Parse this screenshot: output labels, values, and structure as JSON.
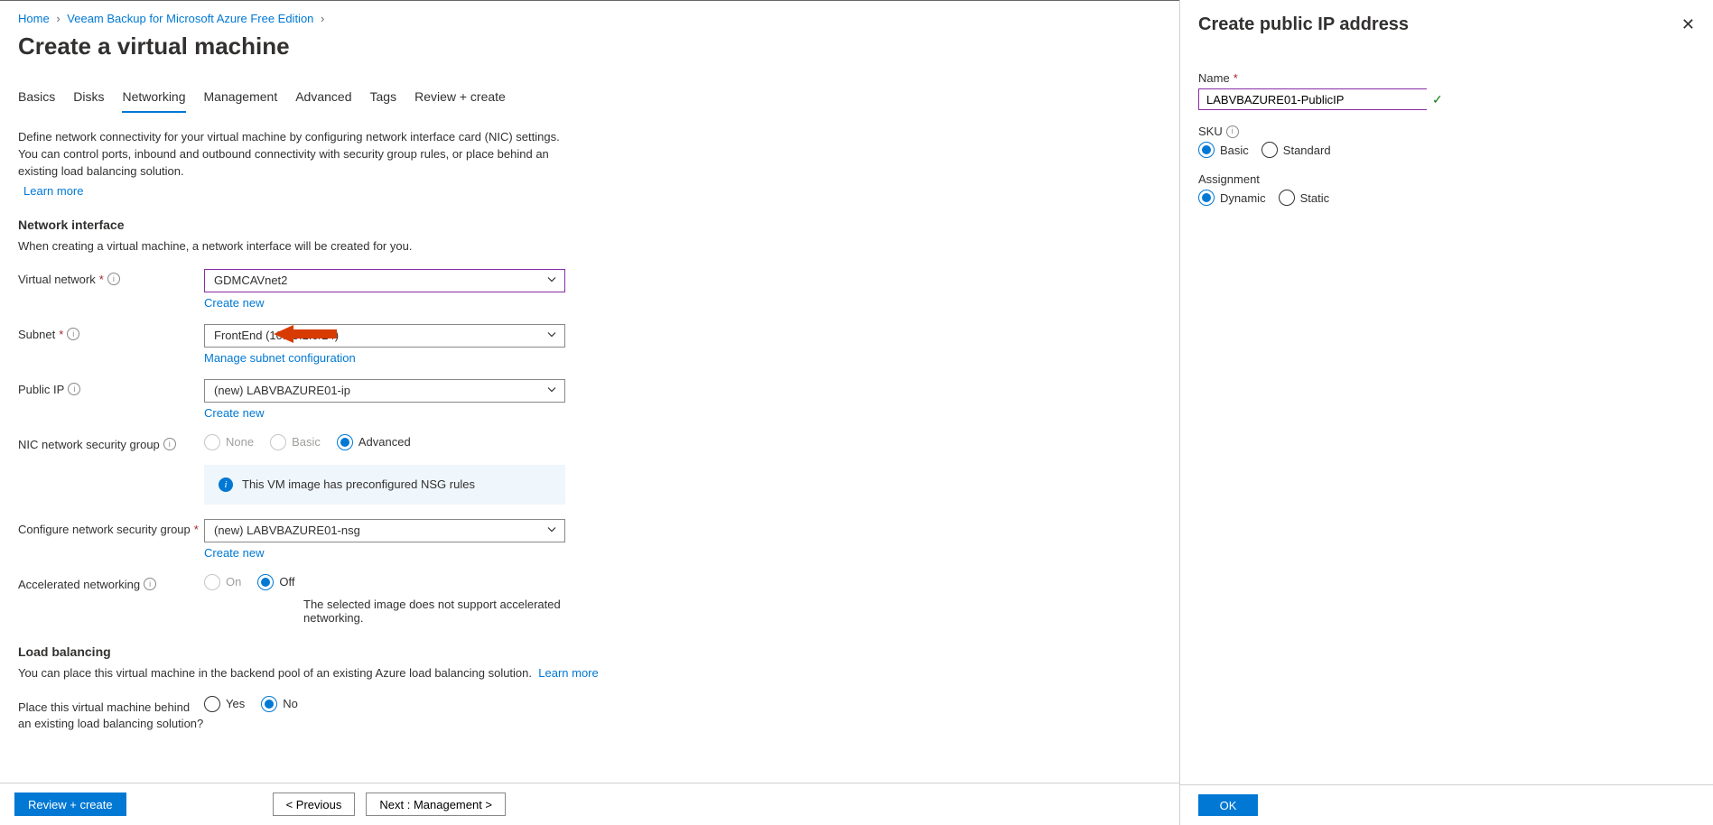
{
  "breadcrumb": {
    "home": "Home",
    "item2": "Veeam Backup for Microsoft Azure Free Edition"
  },
  "page_title": "Create a virtual machine",
  "tabs": [
    "Basics",
    "Disks",
    "Networking",
    "Management",
    "Advanced",
    "Tags",
    "Review + create"
  ],
  "intro_text": "Define network connectivity for your virtual machine by configuring network interface card (NIC) settings. You can control ports, inbound and outbound connectivity with security group rules, or place behind an existing load balancing solution.",
  "learn_more": "Learn more",
  "section_network_interface": "Network interface",
  "ni_helper": "When creating a virtual machine, a network interface will be created for you.",
  "labels": {
    "virtual_network": "Virtual network",
    "subnet": "Subnet",
    "public_ip": "Public IP",
    "nic_nsg": "NIC network security group",
    "configure_nsg": "Configure network security group",
    "accelerated": "Accelerated networking"
  },
  "values": {
    "virtual_network": "GDMCAVnet2",
    "subnet": "FrontEnd (10.15.1.0/24)",
    "public_ip": "(new) LABVBAZURE01-ip",
    "configure_nsg": "(new) LABVBAZURE01-nsg"
  },
  "sublinks": {
    "vnet_create": "Create new",
    "subnet_manage": "Manage subnet configuration",
    "pip_create": "Create new",
    "nsg_create": "Create new"
  },
  "nsg_options": {
    "none": "None",
    "basic": "Basic",
    "advanced": "Advanced"
  },
  "nsg_banner": "This VM image has preconfigured NSG rules",
  "accel_options": {
    "on": "On",
    "off": "Off"
  },
  "accel_note": "The selected image does not support accelerated networking.",
  "lb_title": "Load balancing",
  "lb_text": "You can place this virtual machine in the backend pool of an existing Azure load balancing solution.",
  "lb_label": "Place this virtual machine behind an existing load balancing solution?",
  "lb_options": {
    "yes": "Yes",
    "no": "No"
  },
  "footer": {
    "review": "Review + create",
    "previous": "< Previous",
    "next": "Next : Management >"
  },
  "panel": {
    "title": "Create public IP address",
    "name_label": "Name",
    "name_value": "LABVBAZURE01-PublicIP",
    "sku_label": "SKU",
    "sku_basic": "Basic",
    "sku_standard": "Standard",
    "assign_label": "Assignment",
    "assign_dynamic": "Dynamic",
    "assign_static": "Static",
    "ok": "OK"
  }
}
